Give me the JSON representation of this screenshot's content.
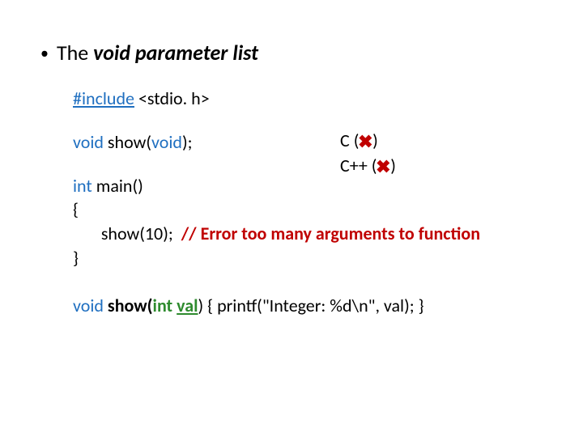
{
  "bullet": {
    "dot": "•",
    "prefix": "The ",
    "emph": "void parameter list"
  },
  "code": {
    "line1_a": "#include",
    "line1_b": " <stdio. h>",
    "decl_a": "void",
    "decl_b": " show(",
    "decl_c": "void",
    "decl_d": ");",
    "main_a": "int",
    "main_b": " main()",
    "brace_open": "{",
    "call_a": "       show(10);  ",
    "call_comment": "// Error too many arguments to function",
    "brace_close": "}",
    "def_a": "void",
    "def_b": " show(",
    "def_c": "int",
    "def_d": " ",
    "def_e": "val",
    "def_f": ") { printf(\"Integer: %d\\n\", val); }"
  },
  "lang": {
    "row1_a": "C   (",
    "row1_b": ")",
    "row2_a": "C++ (",
    "row2_b": ")"
  },
  "icons": {
    "cross": "✖"
  }
}
